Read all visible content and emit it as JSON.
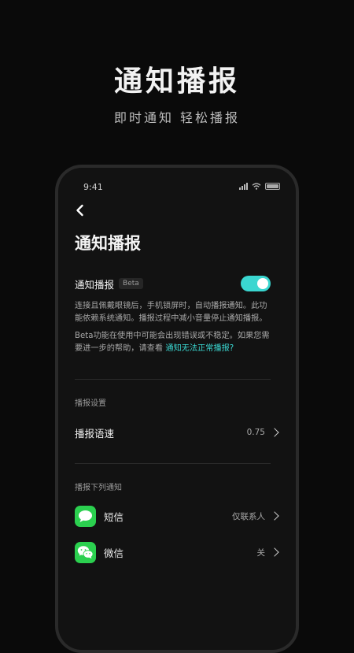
{
  "hero": {
    "title": "通知播报",
    "subtitle": "即时通知 轻松播报"
  },
  "status_bar": {
    "time": "9:41"
  },
  "page": {
    "title": "通知播报"
  },
  "notify_toggle": {
    "label": "通知播报",
    "badge": "Beta",
    "enabled": true,
    "accent_color": "#3ad6d0"
  },
  "descriptions": {
    "desc1": "连接且佩戴眼镜后，手机锁屏时，自动播报通知。此功能依赖系统通知。播报过程中减小音量停止通知播报。",
    "desc2": "Beta功能在使用中可能会出现错误或不稳定。如果您需要进一步的帮助，请查看",
    "help_link": "通知无法正常播报?"
  },
  "sections": {
    "broadcast_settings": "播报设置",
    "broadcast_apps": "播报下列通知"
  },
  "speed": {
    "label": "播报语速",
    "value": "0.75"
  },
  "apps": [
    {
      "name": "短信",
      "value": "仅联系人",
      "icon": "messages-icon"
    },
    {
      "name": "微信",
      "value": "关",
      "icon": "wechat-icon"
    }
  ]
}
